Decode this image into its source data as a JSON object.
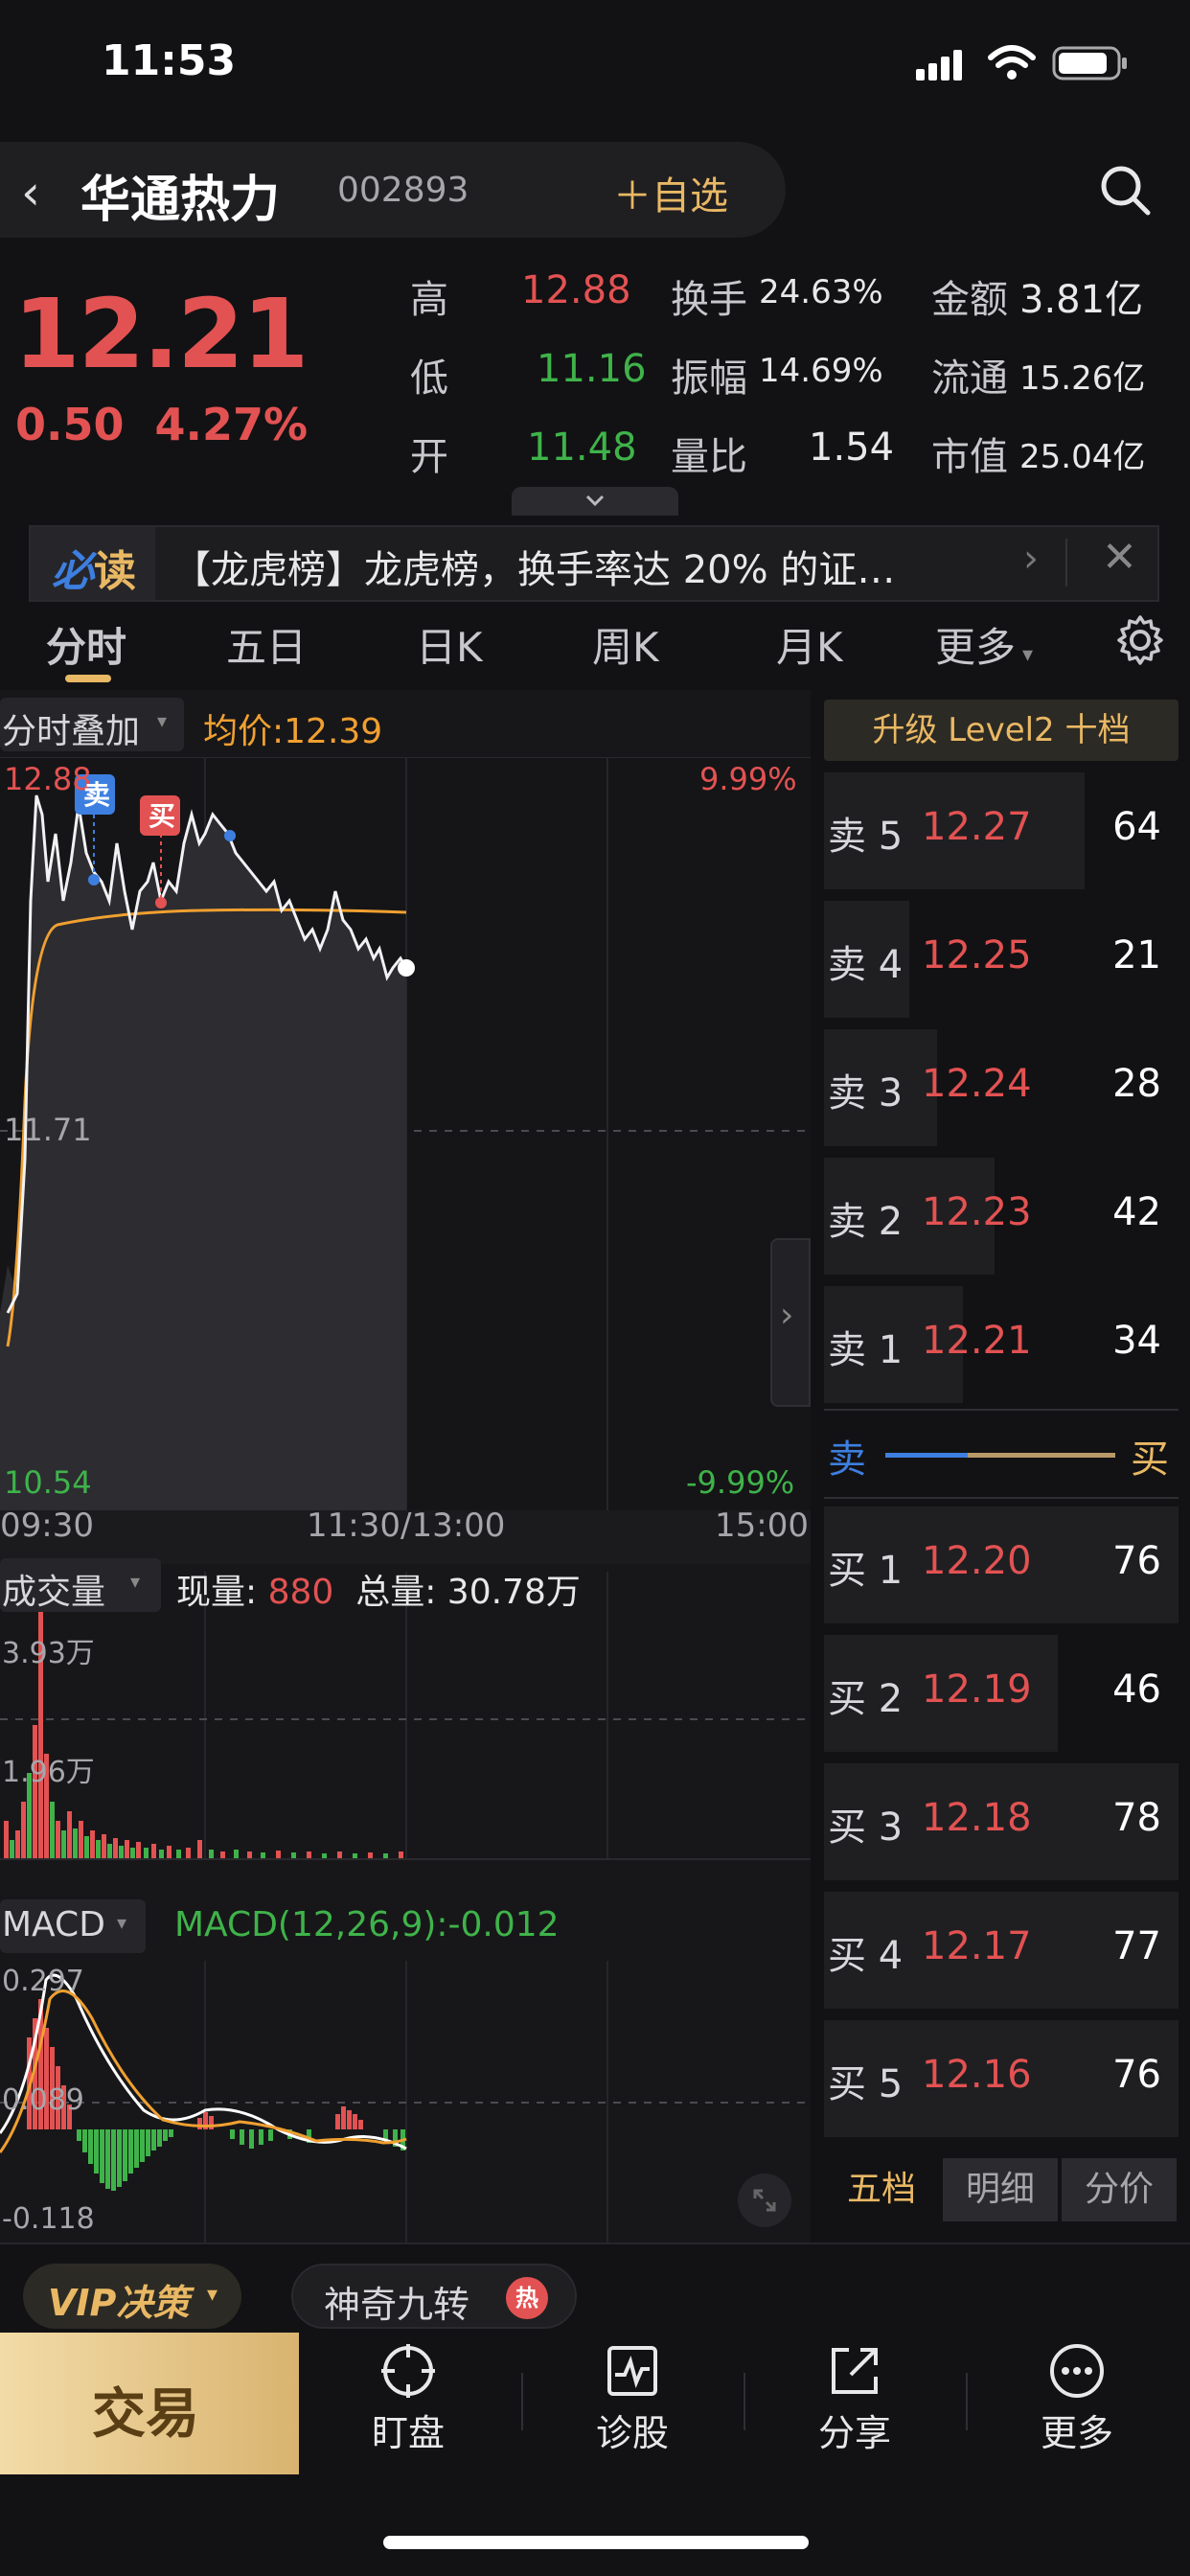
{
  "status": {
    "time": "11:53"
  },
  "header": {
    "back_icon": "chevron-left-icon",
    "stock_name": "华通热力",
    "stock_code": "002893",
    "add_favorite": "＋自选"
  },
  "quote": {
    "price": "12.21",
    "change": "0.50",
    "change_pct": "4.27%",
    "high_label": "高",
    "high": "12.88",
    "low_label": "低",
    "low": "11.16",
    "open_label": "开",
    "open": "11.48",
    "turnover_label": "换手",
    "turnover": "24.63%",
    "amplitude_label": "振幅",
    "amplitude": "14.69%",
    "volume_ratio_label": "量比",
    "volume_ratio": "1.54",
    "amount_label": "金额",
    "amount": "3.81亿",
    "float_label": "流通",
    "float_cap": "15.26亿",
    "mktcap_label": "市值",
    "market_cap": "25.04亿"
  },
  "news": {
    "tag_1": "必",
    "tag_2": "读",
    "headline": "【龙虎榜】龙虎榜，换手率达 20% 的证…"
  },
  "tabs": [
    "分时",
    "五日",
    "日K",
    "周K",
    "月K",
    "更多"
  ],
  "active_tab": "分时",
  "intraday": {
    "overlay_label": "分时叠加",
    "avg_price_label": "均价:12.39",
    "y_max": "12.88",
    "y_mid": "11.71",
    "y_min": "10.54",
    "pct_max": "9.99%",
    "pct_min": "-9.99%",
    "time_start": "09:30",
    "time_mid": "11:30/13:00",
    "time_end": "15:00",
    "sell_marker": "卖",
    "buy_marker": "买"
  },
  "volume": {
    "label": "成交量",
    "current_label": "现量:",
    "current": "880",
    "total_label": "总量:",
    "total": "30.78万",
    "y_max": "3.93万",
    "y_mid": "1.96万"
  },
  "macd": {
    "label": "MACD",
    "value": "MACD(12,26,9):-0.012",
    "y_max": "0.297",
    "y_mid": "0.089",
    "y_min": "-0.118"
  },
  "orderbook": {
    "upgrade": "升级 Level2 十档",
    "asks": [
      {
        "label": "卖 5",
        "price": "12.27",
        "vol": "64",
        "bar": 0.92
      },
      {
        "label": "卖 4",
        "price": "12.25",
        "vol": "21",
        "bar": 0.3
      },
      {
        "label": "卖 3",
        "price": "12.24",
        "vol": "28",
        "bar": 0.4
      },
      {
        "label": "卖 2",
        "price": "12.23",
        "vol": "42",
        "bar": 0.6
      },
      {
        "label": "卖 1",
        "price": "12.21",
        "vol": "34",
        "bar": 0.49
      }
    ],
    "bids": [
      {
        "label": "买 1",
        "price": "12.20",
        "vol": "76",
        "bar": 1.0
      },
      {
        "label": "买 2",
        "price": "12.19",
        "vol": "46",
        "bar": 0.66
      },
      {
        "label": "买 3",
        "price": "12.18",
        "vol": "78",
        "bar": 1.0
      },
      {
        "label": "买 4",
        "price": "12.17",
        "vol": "77",
        "bar": 1.0
      },
      {
        "label": "买 5",
        "price": "12.16",
        "vol": "76",
        "bar": 1.0
      }
    ],
    "sell_word": "卖",
    "buy_word": "买",
    "tabs": [
      "五档",
      "明细",
      "分价"
    ]
  },
  "bottom": {
    "vip_label": "VIP决策",
    "nine_label": "神奇九转",
    "hot_badge": "热",
    "trade": "交易",
    "nav": [
      {
        "label": "盯盘",
        "icon": "crosshair-icon"
      },
      {
        "label": "诊股",
        "icon": "pulse-chart-icon"
      },
      {
        "label": "分享",
        "icon": "share-icon"
      },
      {
        "label": "更多",
        "icon": "more-dots-icon"
      }
    ]
  },
  "colors": {
    "up": "#e35252",
    "down": "#3fb34a",
    "accent": "#e9b864",
    "avg_line": "#f0a030",
    "sell_blue": "#3d7fe0"
  }
}
